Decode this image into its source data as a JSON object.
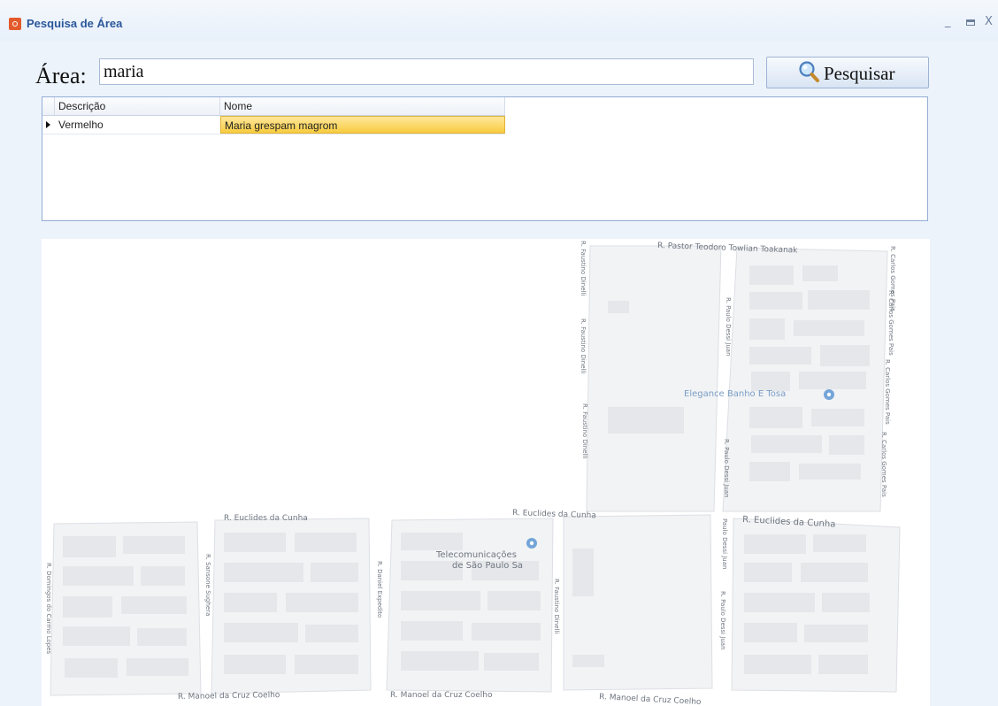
{
  "window": {
    "title": "Pesquisa de Área",
    "controls": {
      "minimize": "_",
      "close": "X"
    }
  },
  "search": {
    "label": "Área:",
    "value": "maria",
    "button_label": "Pesquisar"
  },
  "grid": {
    "columns": [
      "Descrição",
      "Nome"
    ],
    "rows": [
      {
        "descricao": "Vermelho",
        "nome": "Maria grespam magrom",
        "selected": true
      }
    ]
  },
  "map": {
    "streets": {
      "top": "R. Pastor Teodoro Towlian Toakanak",
      "euclides_1": "R. Euclides da Cunha",
      "euclides_2": "R. Euclides da Cunha",
      "euclides_3": "R. Euclides da Cunha",
      "manoel_1": "R. Manoel da Cruz Coelho",
      "manoel_2": "R. Manoel da Cruz Coelho",
      "manoel_3": "R. Manoel da Cruz Coelho",
      "faustino_1": "R. Faustino Dinelli",
      "faustino_2": "R. Faustino Dinelli",
      "faustino_3": "R. Faustino Dinelli",
      "faustino_4": "R. Faustino Dinelli",
      "paulo_1": "R. Paulo Dessi Juan",
      "paulo_2": "R. Paulo Dessi Juan",
      "paulo_3": "Paulo Dessi Juan",
      "paulo_4": "R. Paulo Dessi Juan",
      "carlos_1": "R. Carlos Gomes Pais",
      "carlos_2": "R. Carlos Gomes Pais",
      "carlos_3": "R. Carlos Gomes Pais",
      "carlos_4": "R. Carlos Gomes Pais",
      "domingos": "R. Domingos do Carmo Lopes",
      "sansone": "R. Sansone Sughera",
      "daniel": "R. Daniel Expedito"
    },
    "places": {
      "pet": "Elegance Banho E Tosa",
      "telecom_line1": "Telecomunicações",
      "telecom_line2": "de São Paulo Sa"
    },
    "pin_color": "#74a5d8"
  }
}
